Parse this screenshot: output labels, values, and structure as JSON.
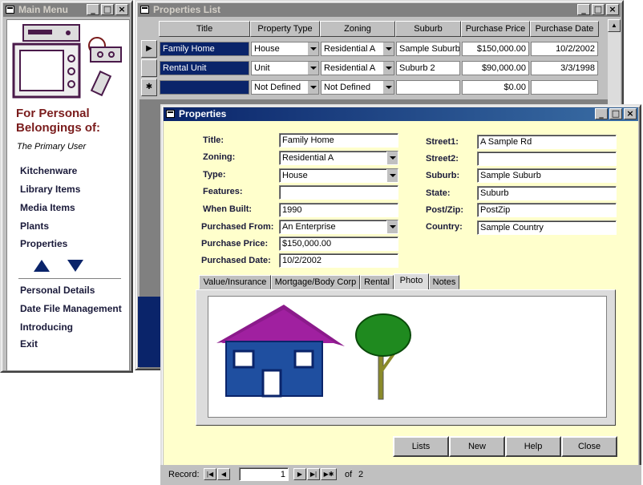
{
  "main_menu": {
    "title": "Main Menu",
    "heading_line1": "For Personal",
    "heading_line2": "Belongings of:",
    "owner": "The Primary User",
    "items": [
      "Kitchenware",
      "Library Items",
      "Media Items",
      "Plants",
      "Properties"
    ],
    "items2": [
      "Personal Details",
      "Date File Management",
      "Introducing",
      "Exit"
    ]
  },
  "properties_list": {
    "title": "Properties List",
    "columns": [
      "Title",
      "Property Type",
      "Zoning",
      "Suburb",
      "Purchase Price",
      "Purchase Date"
    ],
    "rows": [
      {
        "title": "Family Home",
        "type": "House",
        "zoning": "Residential A",
        "suburb": "Sample Suburb",
        "price": "$150,000.00",
        "date": "10/2/2002"
      },
      {
        "title": "Rental Unit",
        "type": "Unit",
        "zoning": "Residential A",
        "suburb": "Suburb 2",
        "price": "$90,000.00",
        "date": "3/3/1998"
      },
      {
        "title": "",
        "type": "Not Defined",
        "zoning": "Not Defined",
        "suburb": "",
        "price": "$0.00",
        "date": ""
      }
    ]
  },
  "properties_form": {
    "title": "Properties",
    "labels": {
      "title": "Title:",
      "zoning": "Zoning:",
      "type": "Type:",
      "features": "Features:",
      "when_built": "When Built:",
      "purchased_from": "Purchased From:",
      "purchase_price": "Purchase Price:",
      "purchased_date": "Purchased Date:",
      "street1": "Street1:",
      "street2": "Street2:",
      "suburb": "Suburb:",
      "state": "State:",
      "post_zip": "Post/Zip:",
      "country": "Country:"
    },
    "values": {
      "title": "Family Home",
      "zoning": "Residential A",
      "type": "House",
      "features": "",
      "when_built": "1990",
      "purchased_from": "An Enterprise",
      "purchase_price": "$150,000.00",
      "purchased_date": "10/2/2002",
      "street1": "A Sample Rd",
      "street2": "",
      "suburb": "Sample Suburb",
      "state": "Suburb",
      "post_zip": "PostZip",
      "country": "Sample Country"
    },
    "tabs": [
      "Value/Insurance",
      "Mortgage/Body Corp",
      "Rental",
      "Photo",
      "Notes"
    ],
    "active_tab": "Photo",
    "buttons": {
      "lists": "Lists",
      "new": "New",
      "help": "Help",
      "close": "Close"
    },
    "record_nav": {
      "label": "Record:",
      "current": "1",
      "of_label": "of",
      "total": "2"
    }
  },
  "colors": {
    "title_active": "#0a246a",
    "title_inactive": "#808080",
    "form_bg": "#ffffcc",
    "heading": "#7a1c1c"
  }
}
